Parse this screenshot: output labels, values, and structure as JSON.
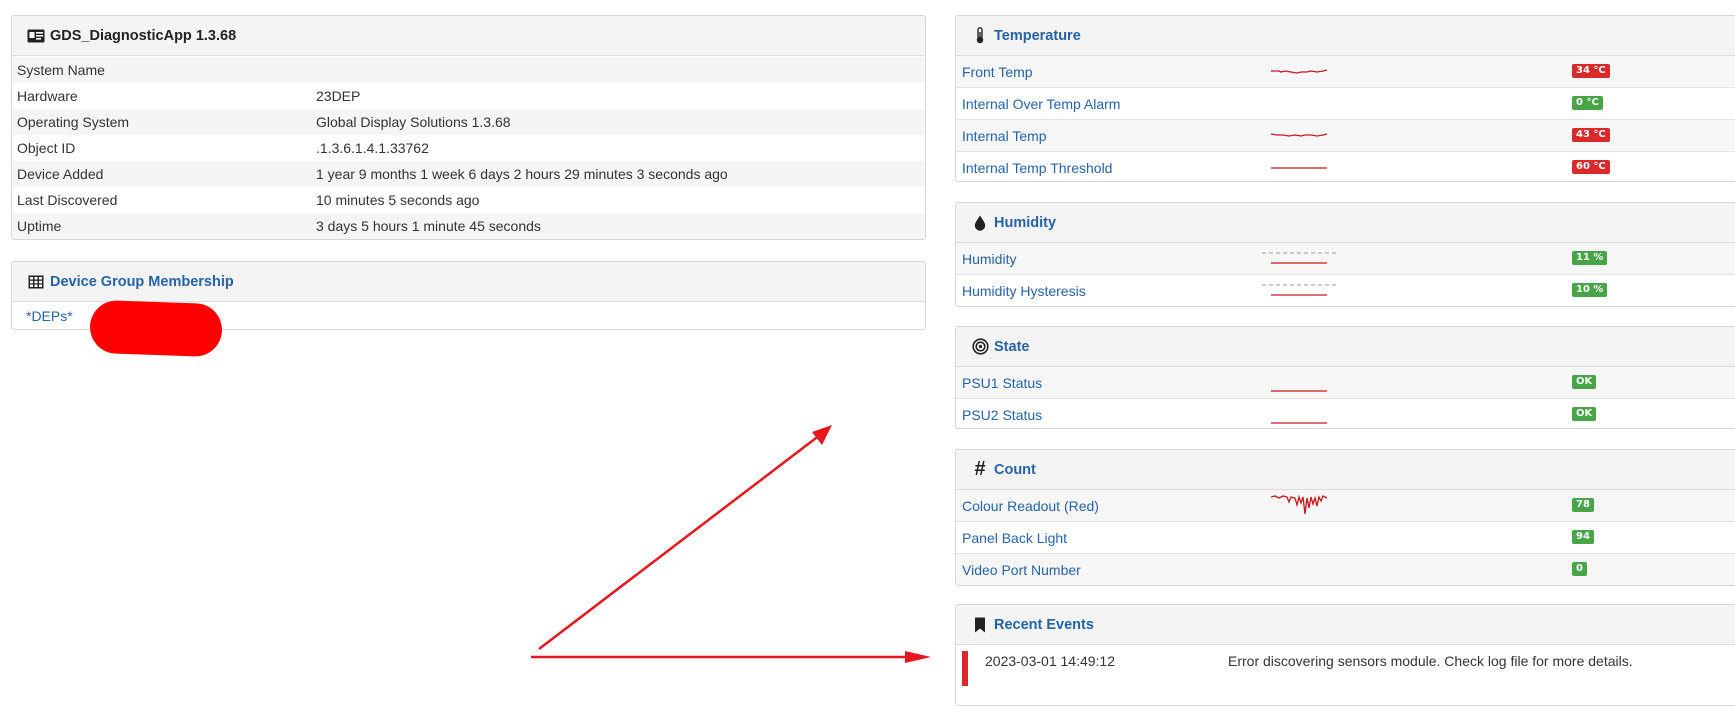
{
  "overview": {
    "title": "GDS_DiagnosticApp 1.3.68",
    "rows": [
      {
        "key": "System Name",
        "value": ""
      },
      {
        "key": "Hardware",
        "value": "23DEP"
      },
      {
        "key": "Operating System",
        "value": "Global Display Solutions 1.3.68"
      },
      {
        "key": "Object ID",
        "value": ".1.3.6.1.4.1.33762"
      },
      {
        "key": "Device Added",
        "value": "1 year 9 months 1 week 6 days 2 hours 29 minutes 3 seconds ago"
      },
      {
        "key": "Last Discovered",
        "value": "10 minutes 5 seconds ago"
      },
      {
        "key": "Uptime",
        "value": "3 days 5 hours 1 minute 45 seconds"
      }
    ]
  },
  "groups": {
    "title": "Device Group Membership",
    "item": "*DEPs*"
  },
  "temperature": {
    "title": "Temperature",
    "rows": [
      {
        "name": "Front Temp",
        "value": "34 °C",
        "status": "red"
      },
      {
        "name": "Internal Over Temp Alarm",
        "value": "0 °C",
        "status": "green"
      },
      {
        "name": "Internal Temp",
        "value": "43 °C",
        "status": "red"
      },
      {
        "name": "Internal Temp Threshold",
        "value": "60 °C",
        "status": "red"
      }
    ]
  },
  "humidity": {
    "title": "Humidity",
    "rows": [
      {
        "name": "Humidity",
        "value": "11 %",
        "status": "green"
      },
      {
        "name": "Humidity Hysteresis",
        "value": "10 %",
        "status": "green"
      }
    ]
  },
  "state": {
    "title": "State",
    "rows": [
      {
        "name": "PSU1 Status",
        "value": "OK",
        "status": "green"
      },
      {
        "name": "PSU2 Status",
        "value": "OK",
        "status": "green"
      }
    ]
  },
  "count": {
    "title": "Count",
    "rows": [
      {
        "name": "Colour Readout (Red)",
        "value": "78",
        "status": "green"
      },
      {
        "name": "Panel Back Light",
        "value": "94",
        "status": "green"
      },
      {
        "name": "Video Port Number",
        "value": "0",
        "status": "green"
      }
    ]
  },
  "events": {
    "title": "Recent Events",
    "items": [
      {
        "time": "2023-03-01 14:49:12",
        "message": "Error discovering sensors module. Check log file for more details."
      }
    ]
  },
  "colors": {
    "link": "#2463a8",
    "badge_red": "#d9292b",
    "badge_green": "#47a447",
    "annotation": "#e8161d"
  },
  "icons": {
    "overview": "id-card-icon",
    "groups": "grid-table-icon",
    "temperature": "thermometer-icon",
    "humidity": "droplet-icon",
    "state": "target-icon",
    "count": "hash-icon",
    "events": "bookmark-icon"
  }
}
